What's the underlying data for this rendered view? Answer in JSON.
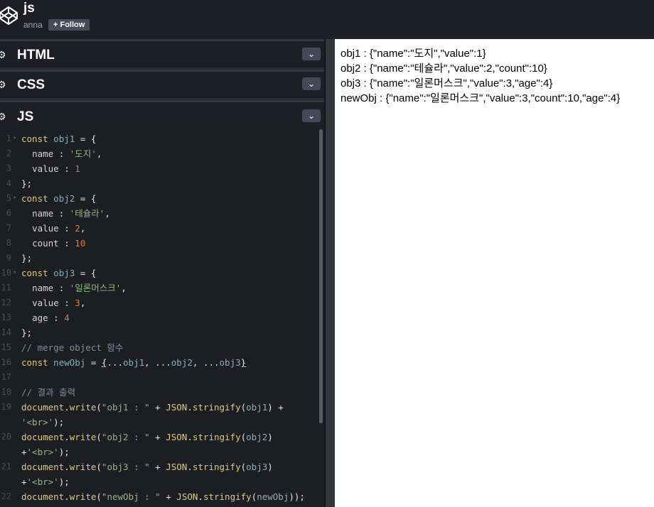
{
  "header": {
    "title": "js",
    "author": "anna",
    "follow_label": "+ Follow"
  },
  "panels": {
    "html": {
      "title": "HTML"
    },
    "css": {
      "title": "CSS"
    },
    "js": {
      "title": "JS"
    }
  },
  "editor": {
    "line_numbers": [
      "1",
      "2",
      "3",
      "4",
      "5",
      "6",
      "7",
      "8",
      "9",
      "10",
      "11",
      "12",
      "13",
      "14",
      "15",
      "16",
      "17",
      "18",
      "19",
      "",
      "20",
      "",
      "21",
      "",
      "22"
    ]
  },
  "preview": {
    "output": [
      "obj1 : {\"name\":\"도지\",\"value\":1}",
      "obj2 : {\"name\":\"테슐라\",\"value\":2,\"count\":10}",
      "obj3 : {\"name\":\"일론머스크\",\"value\":3,\"age\":4}",
      "newObj : {\"name\":\"일론머스크\",\"value\":3,\"count\":10,\"age\":4}"
    ]
  },
  "colors": {
    "header_bg": "#1e1f26",
    "editor_bg": "#1d1e22",
    "keyword": "#ddca7e",
    "variable": "#88afbf",
    "string": "#96b38a",
    "number": "#d08442",
    "comment": "#88899b"
  }
}
